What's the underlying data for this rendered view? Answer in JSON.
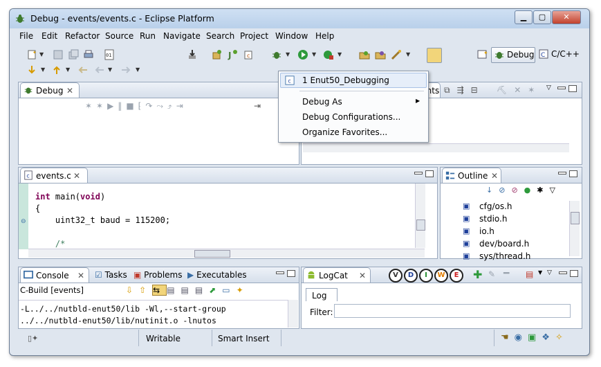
{
  "window": {
    "title": "Debug - events/events.c - Eclipse Platform"
  },
  "menu": [
    "File",
    "Edit",
    "Refactor",
    "Source",
    "Run",
    "Navigate",
    "Search",
    "Project",
    "Window",
    "Help"
  ],
  "perspectives": {
    "debug": "Debug",
    "cpp": "C/C++"
  },
  "debug_menu": {
    "recent": "1 Enut50_Debugging",
    "debug_as": "Debug As",
    "configs": "Debug Configurations...",
    "organize": "Organize Favorites..."
  },
  "views": {
    "debug_tab": "Debug",
    "breakpoints_tab": "oints",
    "editor_tab": "events.c",
    "outline_tab": "Outline",
    "console_tab": "Console",
    "tasks_tab": "Tasks",
    "problems_tab": "Problems",
    "executables_tab": "Executables",
    "logcat_tab": "LogCat"
  },
  "editor": {
    "lines": [
      {
        "prefix": "",
        "kw": "int",
        "rest": " main(",
        "kw2": "void",
        "tail": ")"
      },
      {
        "prefix": "{",
        "kw": "",
        "rest": "",
        "kw2": "",
        "tail": ""
      },
      {
        "prefix": "    uint32_t baud = 115200;",
        "kw": "",
        "rest": "",
        "kw2": "",
        "tail": ""
      },
      {
        "prefix": "",
        "kw": "",
        "rest": "",
        "kw2": "",
        "tail": ""
      },
      {
        "prefix": "    /*",
        "kw": "",
        "rest": "",
        "kw2": "",
        "tail": ""
      }
    ]
  },
  "outline": {
    "items": [
      "cfg/os.h",
      "stdio.h",
      "io.h",
      "dev/board.h",
      "sys/thread.h"
    ]
  },
  "console": {
    "label": "C-Build [events]",
    "lines": [
      "-L../../nutbld-enut50/lib -Wl,--start-group",
      "../../nutbld-enut50/lib/nutinit.o -lnutos"
    ]
  },
  "logcat": {
    "levels": [
      "V",
      "D",
      "I",
      "W",
      "E"
    ],
    "level_colors": [
      "#333333",
      "#1e3f9a",
      "#1e8a2a",
      "#e07b00",
      "#cc1f1f"
    ],
    "log_tab": "Log",
    "filter_label": "Filter:",
    "filter_value": ""
  },
  "status": {
    "writable": "Writable",
    "insert_mode": "Smart Insert"
  }
}
